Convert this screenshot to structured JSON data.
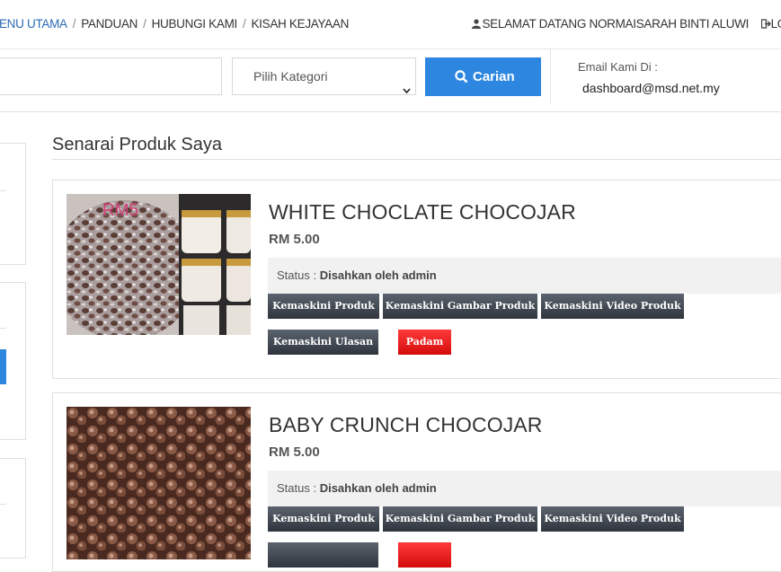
{
  "nav": {
    "items": [
      "MENU UTAMA",
      "PANDUAN",
      "HUBUNGI KAMI",
      "KISAH KEJAYAAN"
    ],
    "user_greeting": "SELAMAT DATANG NORMAISARAH BINTI ALUWI",
    "logout_label": "LO",
    "user_icon": "user-icon",
    "logout_icon": "logout-icon"
  },
  "search": {
    "keyword_value": "",
    "category_selected": "Pilih Kategori",
    "button_label": "Carian",
    "email_label": "Email Kami Di :",
    "email_value": "dashboard@msd.net.my"
  },
  "page": {
    "title": "Senarai Produk Saya"
  },
  "products": [
    {
      "name": "WHITE CHOCLATE CHOCOJAR",
      "price": "RM 5.00",
      "status_label": "Status :",
      "status_value": "Disahkan oleh admin",
      "thumb_text": "RM5",
      "actions": [
        "Kemaskini Produk",
        "Kemaskini Gambar Produk",
        "Kemaskini Video Produk",
        "Kemaskini Ulasan",
        "Padam"
      ]
    },
    {
      "name": "BABY CRUNCH CHOCOJAR",
      "price": "RM 5.00",
      "status_label": "Status :",
      "status_value": "Disahkan oleh admin",
      "actions": [
        "Kemaskini Produk",
        "Kemaskini Gambar Produk",
        "Kemaskini Video Produk"
      ]
    }
  ],
  "colors": {
    "primary": "#2d87e0",
    "danger": "#e81e1e",
    "dark_button": "#3f464f"
  }
}
